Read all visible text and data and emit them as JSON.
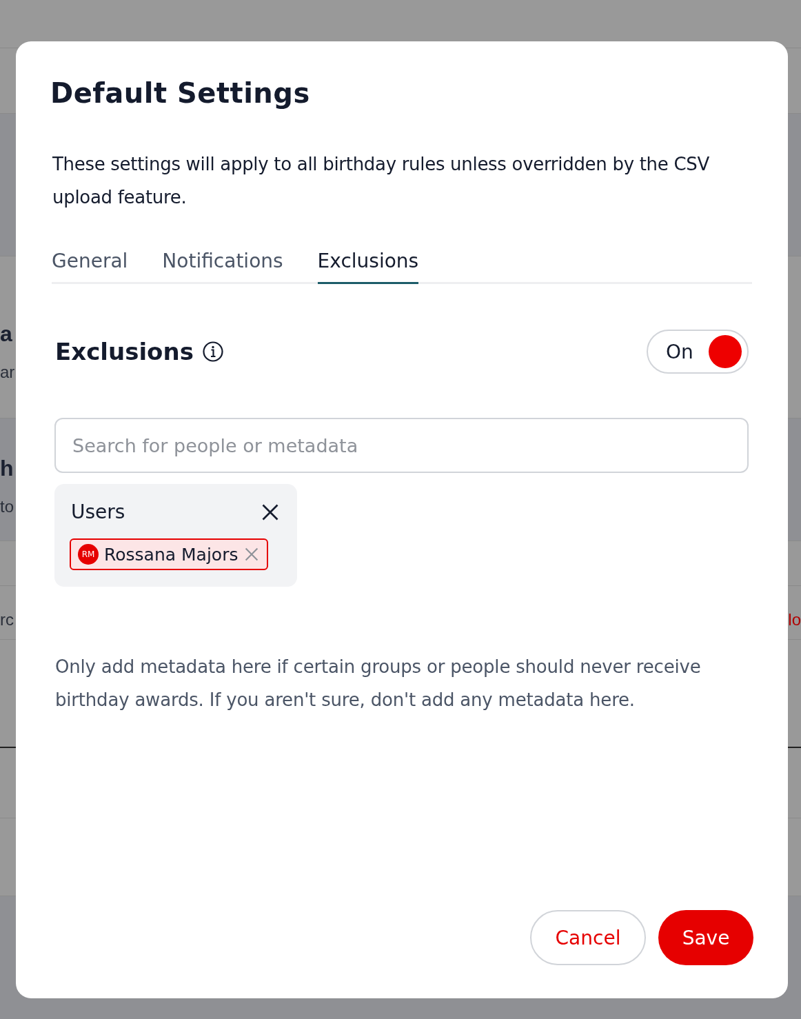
{
  "backdrop": {
    "left_texts": [
      "a",
      "ar",
      "h",
      "to",
      "rc"
    ],
    "right_texts": [
      "lo"
    ]
  },
  "dialog": {
    "title": "Default Settings",
    "description": "These settings will apply to all birthday rules unless overridden by the CSV upload feature.",
    "tabs": [
      {
        "label": "General",
        "selected": false
      },
      {
        "label": "Notifications",
        "selected": false
      },
      {
        "label": "Exclusions",
        "selected": true
      }
    ],
    "section": {
      "title": "Exclusions",
      "toggle": {
        "label": "On",
        "on": true
      }
    },
    "search": {
      "placeholder": "Search for people or metadata"
    },
    "groups": [
      {
        "title": "Users",
        "chips": [
          {
            "initials": "RM",
            "name": "Rossana Majors"
          }
        ]
      }
    ],
    "note": "Only add metadata here if certain groups or people should never receive birthday awards. If you aren't sure, don't add any metadata here.",
    "buttons": [
      {
        "label": "Cancel",
        "kind": "secondary"
      },
      {
        "label": "Save",
        "kind": "primary"
      }
    ]
  }
}
